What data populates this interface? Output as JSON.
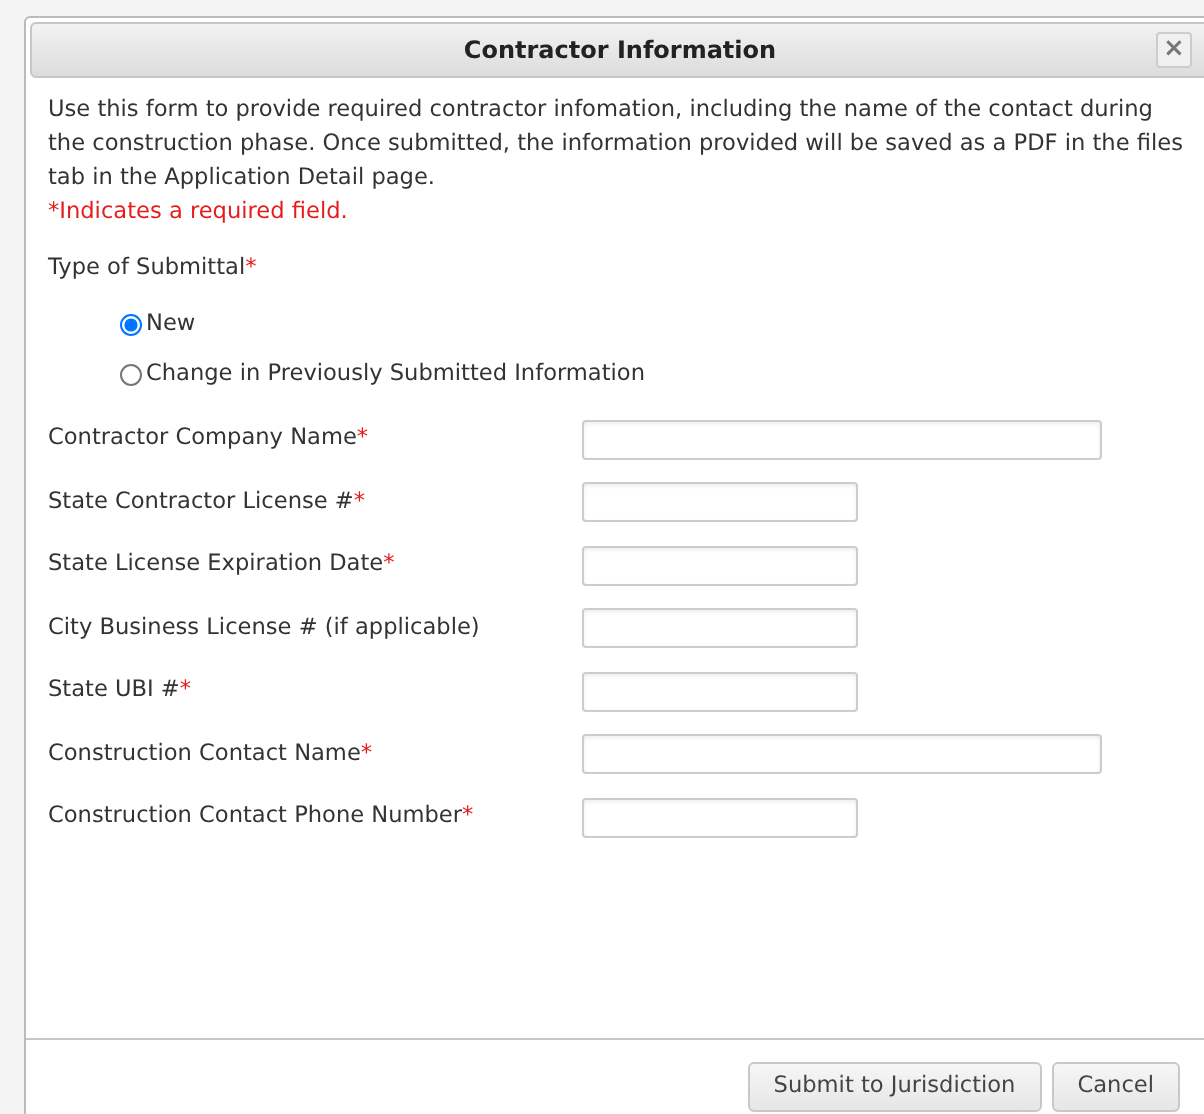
{
  "dialog": {
    "title": "Contractor Information",
    "close": "×"
  },
  "intro": "Use this form to provide required contractor infomation, including the name of the contact during the construction phase. Once submitted, the information provided will be saved as a PDF in the files tab in the Application Detail page.",
  "required_note": "*Indicates a required field.",
  "submittal": {
    "label": "Type of Submittal",
    "required_mark": "*",
    "options": [
      {
        "label": "New",
        "selected": true
      },
      {
        "label": "Change in Previously Submitted Information",
        "selected": false
      }
    ]
  },
  "fields": [
    {
      "label": "Contractor Company Name",
      "required_mark": "*",
      "kind": "wide"
    },
    {
      "label": "State Contractor License #",
      "required_mark": "*",
      "kind": "narrow"
    },
    {
      "label": "State License Expiration Date",
      "required_mark": "*",
      "kind": "narrow"
    },
    {
      "label": "City Business License # (if applicable)",
      "kind": "narrow"
    },
    {
      "label": "State UBI #",
      "required_mark": "*",
      "kind": "narrow"
    },
    {
      "label": "Construction Contact Name",
      "required_mark": "*",
      "kind": "wide"
    },
    {
      "label": "Construction Contact Phone Number",
      "required_mark": "*",
      "kind": "narrow"
    }
  ],
  "buttons": [
    "Submit to Jurisdiction",
    "Cancel"
  ]
}
